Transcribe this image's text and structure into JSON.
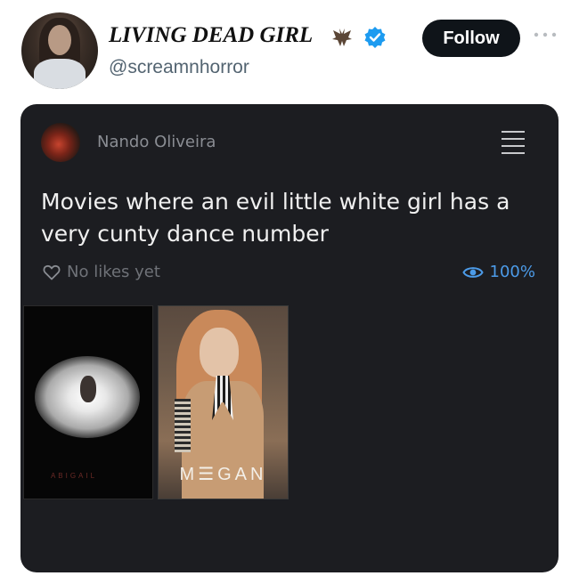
{
  "header": {
    "display_name": "LIVING DEAD GIRL",
    "handle": "@screamnhorror",
    "follow_label": "Follow",
    "name_emoji": "bat-icon",
    "verified": "verified-icon",
    "verified_color": "#1d9bf0"
  },
  "card": {
    "author": "Nando Oliveira",
    "text": "Movies where an evil little white girl has a very cunty dance number",
    "likes": "No likes yet",
    "views": "100%",
    "accent_color": "#4c9be8",
    "posters": [
      {
        "title": "ABIGAIL"
      },
      {
        "title": "M☰GAN"
      }
    ]
  }
}
